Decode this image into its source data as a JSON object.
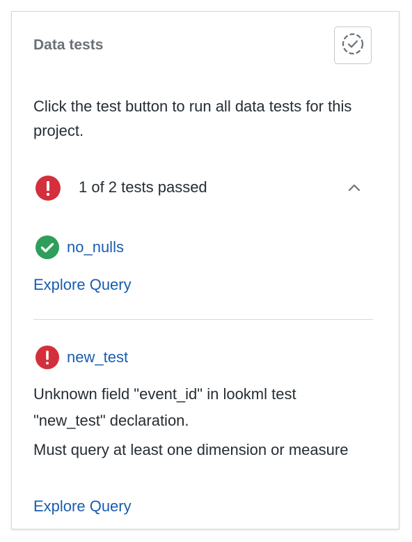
{
  "header": {
    "title": "Data tests"
  },
  "intro": {
    "text": "Click the test button to run all data tests for this project."
  },
  "summary": {
    "text": "1 of 2 tests passed"
  },
  "tests": [
    {
      "name": "no_nulls",
      "status": "passed",
      "explore_label": "Explore Query"
    },
    {
      "name": "new_test",
      "status": "failed",
      "messages": [
        "Unknown field \"event_id\" in lookml test \"new_test\" declaration.",
        "Must query at least one dimension or measure"
      ],
      "explore_label": "Explore Query"
    }
  ],
  "colors": {
    "error": "#d32f3c",
    "success": "#2e9e5b",
    "link": "#1a5cb0"
  }
}
